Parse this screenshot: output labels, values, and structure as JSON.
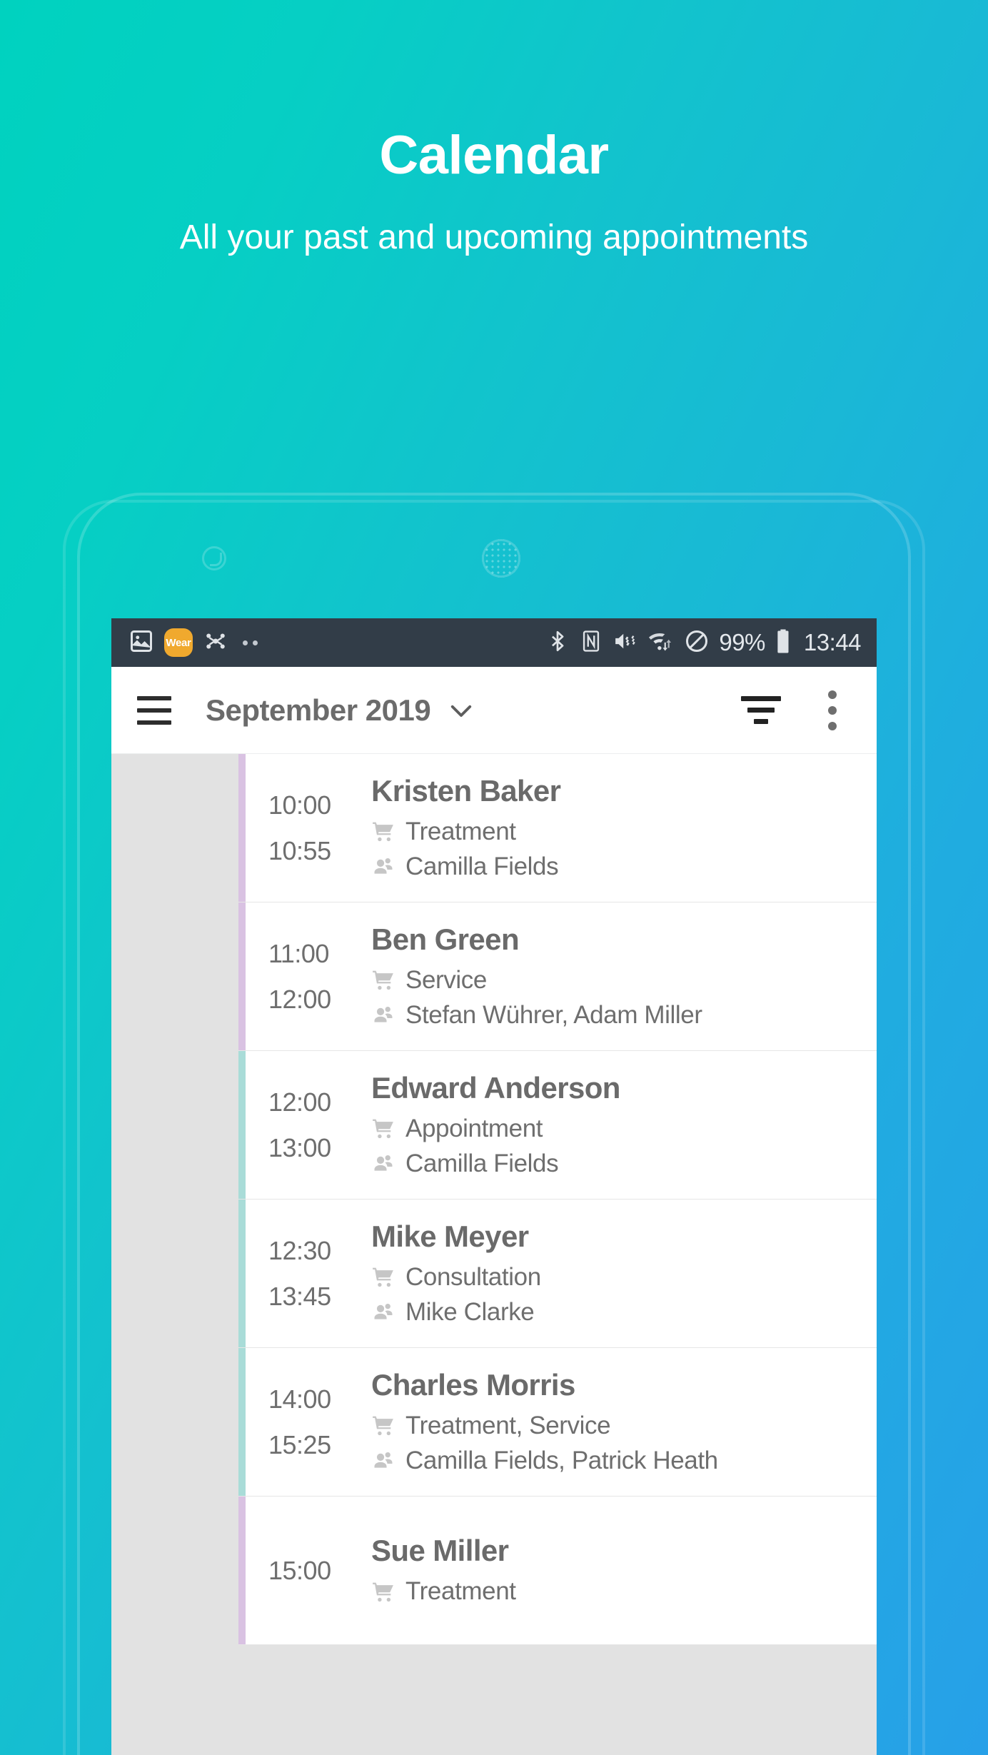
{
  "promo": {
    "title": "Calendar",
    "subtitle": "All your past and upcoming appointments"
  },
  "colors": {
    "bg_gradient_start": "#00d2bf",
    "bg_gradient_end": "#27a0e8",
    "status_bar_bg": "#323d48",
    "gutter_gray": "#e2e2e2",
    "accent_lavender": "#d9c2e2",
    "accent_teal": "#a9dcd8",
    "wear_badge": "#f0a92e",
    "text_gray": "#6e6e6e"
  },
  "status_bar": {
    "left_icons": [
      "image-icon",
      "wear-icon",
      "nodes-icon",
      "more-dots-icon"
    ],
    "wear_label": "Wear",
    "right_icons": [
      "bluetooth-icon",
      "nfc-icon",
      "volume-mute-icon",
      "wifi-icon",
      "do-not-disturb-icon",
      "battery-icon"
    ],
    "battery_percent": "99%",
    "clock": "13:44"
  },
  "toolbar": {
    "menu_icon": "hamburger-icon",
    "title": "September 2019",
    "dropdown_icon": "chevron-down-icon",
    "filter_icon": "filter-icon",
    "overflow_icon": "overflow-menu-icon"
  },
  "agenda": {
    "service_icon": "shopping-cart-icon",
    "staff_icon": "people-icon",
    "appointments": [
      {
        "start": "10:00",
        "end": "10:55",
        "client": "Kristen Baker",
        "services": "Treatment",
        "staff": "Camilla Fields",
        "accent": "#d9c2e2"
      },
      {
        "start": "11:00",
        "end": "12:00",
        "client": "Ben Green",
        "services": "Service",
        "staff": "Stefan Wührer, Adam Miller",
        "accent": "#d9c2e2"
      },
      {
        "start": "12:00",
        "end": "13:00",
        "client": "Edward Anderson",
        "services": "Appointment",
        "staff": "Camilla Fields",
        "accent": "#a9dcd8"
      },
      {
        "start": "12:30",
        "end": "13:45",
        "client": "Mike Meyer",
        "services": "Consultation",
        "staff": "Mike Clarke",
        "accent": "#a9dcd8"
      },
      {
        "start": "14:00",
        "end": "15:25",
        "client": "Charles Morris",
        "services": "Treatment, Service",
        "staff": "Camilla Fields, Patrick Heath",
        "accent": "#a9dcd8"
      },
      {
        "start": "15:00",
        "end": "",
        "client": "Sue Miller",
        "services": "Treatment",
        "staff": "",
        "accent": "#d9c2e2"
      }
    ]
  }
}
